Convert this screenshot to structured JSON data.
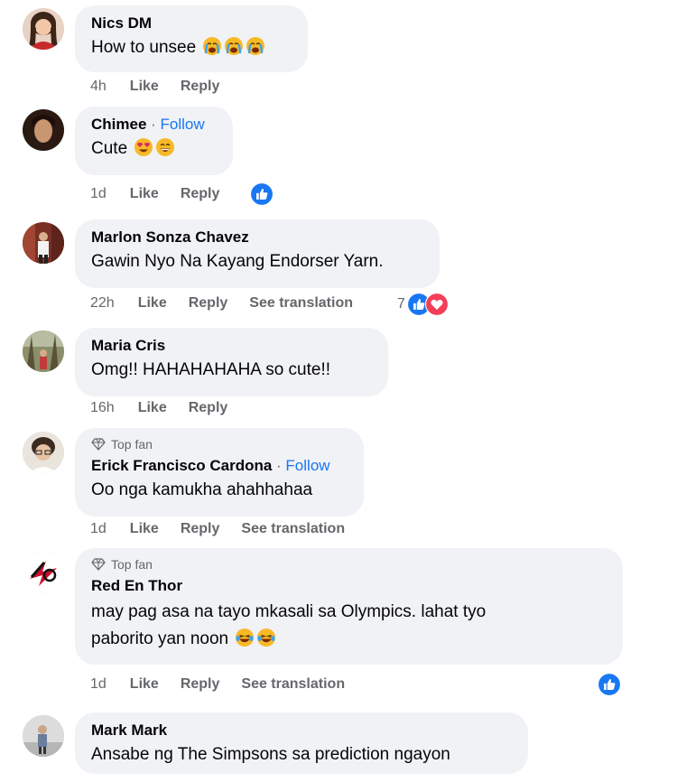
{
  "comments": [
    {
      "name": "Nics DM",
      "text": "How to unsee",
      "emoji_icons": [
        "crying-face-icon",
        "crying-face-icon",
        "crying-face-icon"
      ],
      "time": "4h",
      "like": "Like",
      "reply": "Reply"
    },
    {
      "name": "Chimee",
      "dot": " · ",
      "follow": "Follow",
      "text": "Cute",
      "emoji_icons": [
        "heart-eyes-icon",
        "grinning-face-icon"
      ],
      "time": "1d",
      "like": "Like",
      "reply": "Reply",
      "reactions": [
        "like-reaction-icon"
      ]
    },
    {
      "name": "Marlon Sonza Chavez",
      "text": "Gawin Nyo Na Kayang Endorser Yarn.",
      "time": "22h",
      "like": "Like",
      "reply": "Reply",
      "see_translation": "See translation",
      "reaction_count": "7",
      "reactions": [
        "like-reaction-icon",
        "love-reaction-icon"
      ]
    },
    {
      "name": "Maria Cris",
      "text": "Omg!! HAHAHAHAHA so cute!!",
      "time": "16h",
      "like": "Like",
      "reply": "Reply"
    },
    {
      "badge": "Top fan",
      "name": "Erick Francisco Cardona",
      "dot": " · ",
      "follow": "Follow",
      "text": "Oo nga kamukha ahahhahaa",
      "time": "1d",
      "like": "Like",
      "reply": "Reply",
      "see_translation": "See translation"
    },
    {
      "badge": "Top fan",
      "name": "Red En Thor",
      "text_line1": "may pag asa na tayo mkasali sa Olympics. lahat tyo",
      "text_line2": "paborito yan noon",
      "emoji_icons": [
        "laughing-tears-icon",
        "laughing-tears-icon"
      ],
      "time": "1d",
      "like": "Like",
      "reply": "Reply",
      "see_translation": "See translation",
      "reactions": [
        "like-reaction-icon"
      ]
    },
    {
      "name": "Mark Mark",
      "text": "Ansabe ng The Simpsons sa prediction ngayon"
    }
  ],
  "colors": {
    "bubble": "#f0f2f5",
    "meta_text": "#65676b",
    "follow_link": "#1877f2",
    "like_blue": "#1877f2",
    "love_red": "#f33e58"
  }
}
